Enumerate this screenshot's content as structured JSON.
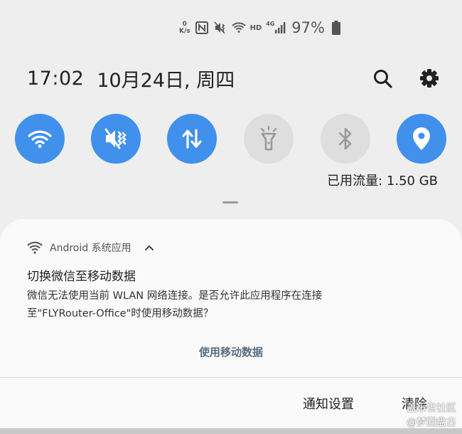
{
  "status_bar": {
    "net_speed_value": "0",
    "net_speed_unit": "K/s",
    "nfc_icon": "nfc-icon",
    "mute_icon": "vibrate-mute-icon",
    "wifi_icon": "wifi-icon",
    "hd_label": "HD",
    "network_label": "4G",
    "battery_percent": "97%"
  },
  "header": {
    "time": "17:02",
    "date": "10月24日, 周四"
  },
  "quick_settings": {
    "tiles": [
      {
        "name": "wifi",
        "icon": "wifi-icon",
        "active": true
      },
      {
        "name": "sound",
        "icon": "vibrate-mute-icon",
        "active": true
      },
      {
        "name": "mobile-data",
        "icon": "data-arrows-icon",
        "active": true
      },
      {
        "name": "flashlight",
        "icon": "flashlight-icon",
        "active": false
      },
      {
        "name": "bluetooth",
        "icon": "bluetooth-icon",
        "active": false
      },
      {
        "name": "location",
        "icon": "location-pin-icon",
        "active": true
      }
    ],
    "data_usage": "已用流量: 1.50 GB"
  },
  "notification": {
    "app_name": "Android 系统应用",
    "title": "切换微信至移动数据",
    "body_line1": "微信无法使用当前 WLAN 网络连接。是否允许此应用程序在连接",
    "body_line2": "至\"FLYRouter-Office\"时使用移动数据？",
    "action_label": "使用移动数据"
  },
  "panel_actions": {
    "settings_label": "通知设置",
    "clear_label": "清除"
  },
  "watermark": {
    "line1": "盖乐世社区",
    "line2": "@梦回盘古"
  },
  "colors": {
    "tile_active": "#4090ec",
    "tile_inactive": "#dedede",
    "action_text": "#5a6d80"
  }
}
